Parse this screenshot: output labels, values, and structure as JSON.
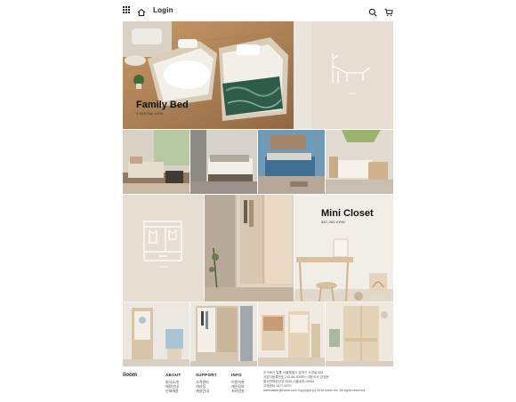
{
  "header": {
    "login_label": "Login",
    "icons": [
      "grid-menu-icon",
      "home-icon",
      "search-icon",
      "cart-icon"
    ]
  },
  "hero": {
    "title": "Family Bed",
    "price": "1,005,000 KRW"
  },
  "category_beds": {
    "caption": "Beds"
  },
  "category_closets": {
    "caption": "Closets"
  },
  "feature_closet": {
    "title": "Mini Closet",
    "price": "387,000 KRW"
  },
  "footer": {
    "brand": "iloom",
    "sections": [
      {
        "title": "ABOUT",
        "links": [
          "회사소개",
          "매장안내",
          "인재채용"
        ]
      },
      {
        "title": "SUPPORT",
        "links": [
          "고객센터",
          "대리점",
          "개설안내"
        ]
      },
      {
        "title": "INFO",
        "links": [
          "이용약관",
          "개인정보",
          "처리방침"
        ]
      }
    ],
    "company_info": [
      "주식회사 일룸 서울특별시 송파구 오금로 555",
      "사업자등록번호 215-86-30000 | 대표이사 강성문",
      "통신판매업신고 2009-서울송파-00061",
      "고객센터 1577-5670"
    ],
    "email_copyright": "webmaster@iloom.com Copyright (c) 2016 iloom Inc. All rights reserved"
  },
  "colors": {
    "beige": "#e7ddd2",
    "white_line_art": "#ffffff",
    "text_dark": "#222222"
  }
}
